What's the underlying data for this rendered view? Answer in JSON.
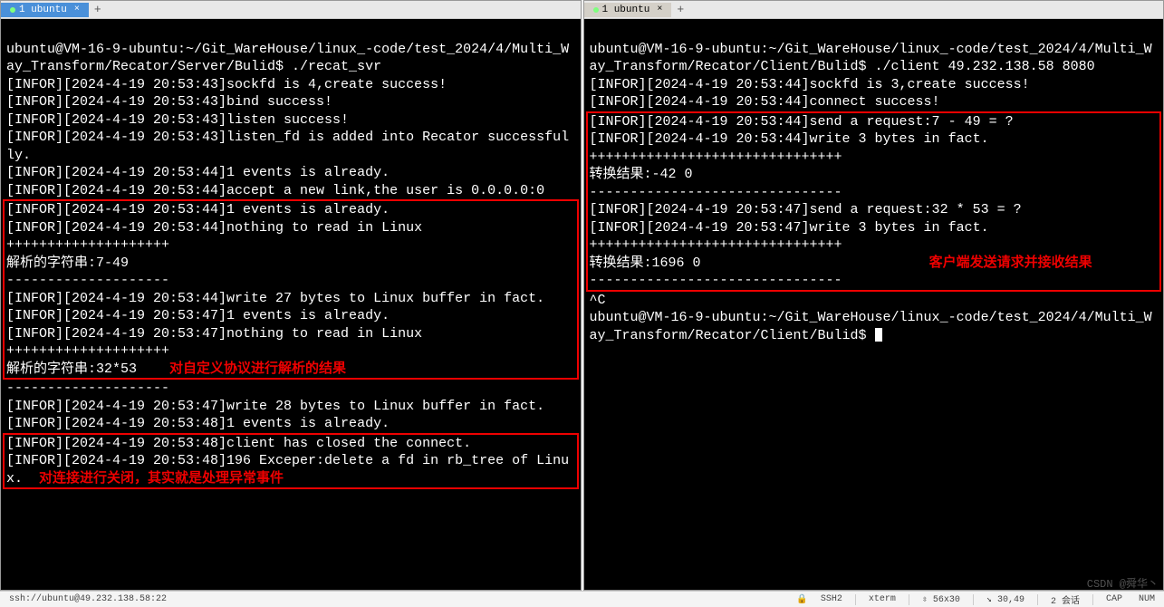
{
  "left": {
    "tab_label": "1 ubuntu",
    "prompt": "ubuntu@VM-16-9-ubuntu:~/Git_WareHouse/linux_-code/test_2024/4/Multi_Way_Transform/Recator/Server/Bulid$ ./recat_svr",
    "lines_pre": [
      "[INFOR][2024-4-19 20:53:43]sockfd is 4,create success!",
      "[INFOR][2024-4-19 20:53:43]bind success!",
      "[INFOR][2024-4-19 20:53:43]listen success!",
      "[INFOR][2024-4-19 20:53:43]listen_fd is added into Recator successfully.",
      "[INFOR][2024-4-19 20:53:44]1 events is already.",
      "[INFOR][2024-4-19 20:53:44]accept a new link,the user is 0.0.0.0:0"
    ],
    "box1_lines": [
      "[INFOR][2024-4-19 20:53:44]1 events is already.",
      "[INFOR][2024-4-19 20:53:44]nothing to read in Linux",
      "++++++++++++++++++++",
      "解析的字符串:7-49",
      "--------------------",
      "[INFOR][2024-4-19 20:53:44]write 27 bytes to Linux buffer in fact.",
      "[INFOR][2024-4-19 20:53:47]1 events is already.",
      "[INFOR][2024-4-19 20:53:47]nothing to read in Linux",
      "++++++++++++++++++++"
    ],
    "box1_last": "解析的字符串:32*53",
    "box1_annot": "对自定义协议进行解析的结果",
    "lines_mid": [
      "--------------------",
      "[INFOR][2024-4-19 20:53:47]write 28 bytes to Linux buffer in fact.",
      "[INFOR][2024-4-19 20:53:48]1 events is already."
    ],
    "box2_lines": [
      "[INFOR][2024-4-19 20:53:48]client has closed the connect."
    ],
    "box2_last": "[INFOR][2024-4-19 20:53:48]196 Exceper:delete a fd in rb_tree of Linux.",
    "box2_annot": "对连接进行关闭，其实就是处理异常事件"
  },
  "right": {
    "tab_label": "1 ubuntu",
    "prompt": "ubuntu@VM-16-9-ubuntu:~/Git_WareHouse/linux_-code/test_2024/4/Multi_Way_Transform/Recator/Client/Bulid$ ./client 49.232.138.58 8080",
    "lines_pre": [
      "[INFOR][2024-4-19 20:53:44]sockfd is 3,create success!",
      "[INFOR][2024-4-19 20:53:44]connect success!"
    ],
    "box_lines": [
      "[INFOR][2024-4-19 20:53:44]send a request:7 - 49 = ?",
      "[INFOR][2024-4-19 20:53:44]write 3 bytes in fact.",
      "+++++++++++++++++++++++++++++++",
      "转换结果:-42 0",
      "-------------------------------",
      "[INFOR][2024-4-19 20:53:47]send a request:32 * 53 = ?",
      "[INFOR][2024-4-19 20:53:47]write 3 bytes in fact.",
      "+++++++++++++++++++++++++++++++"
    ],
    "box_last_a": "转换结果:1696 0",
    "box_annot": "客户端发送请求并接收结果",
    "box_last_b": "-------------------------------",
    "lines_post": [
      "^C"
    ],
    "prompt2": "ubuntu@VM-16-9-ubuntu:~/Git_WareHouse/linux_-code/test_2024/4/Multi_Way_Transform/Recator/Client/Bulid$ "
  },
  "statusbar": {
    "conn": "ssh://ubuntu@49.232.138.58:22",
    "ssh": "SSH2",
    "term": "xterm",
    "size": "⇳ 56x30",
    "pos": "↘ 30,49",
    "sessions": "2 会话",
    "cap": "CAP",
    "num": "NUM"
  },
  "watermark": "CSDN @舜华丶"
}
